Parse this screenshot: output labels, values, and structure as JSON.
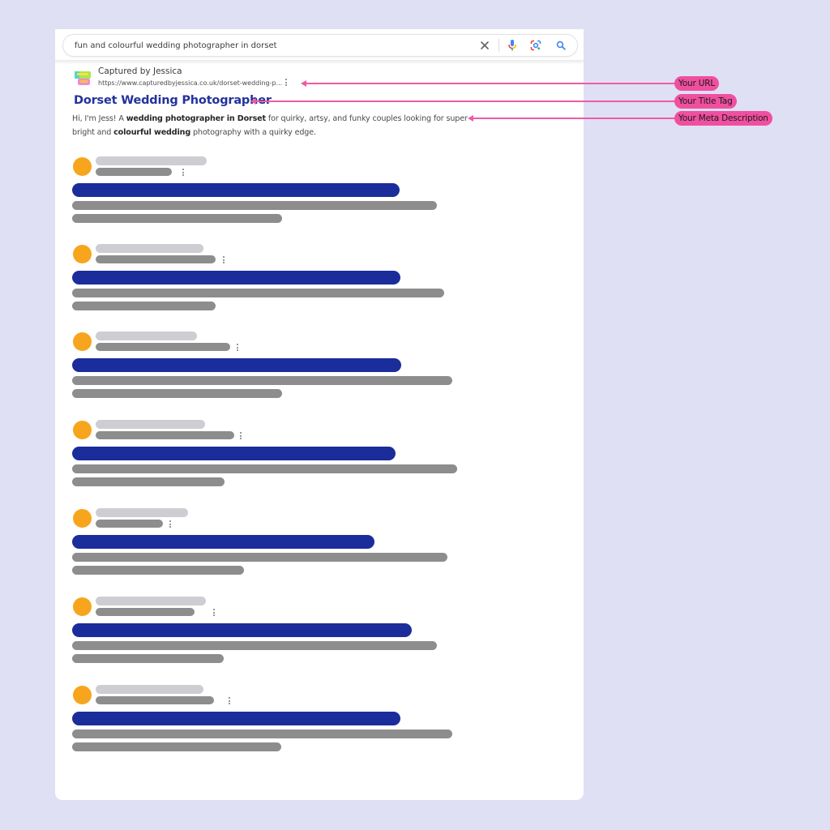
{
  "search": {
    "query": "fun and colourful wedding photographer in dorset",
    "clear_icon": "close-icon",
    "mic_icon": "microphone-icon",
    "lens_icon": "google-lens-icon",
    "search_icon": "search-icon"
  },
  "featured_result": {
    "site_name": "Captured by Jessica",
    "url": "https://www.capturedbyjessica.co.uk/dorset-wedding-p...",
    "title": "Dorset Wedding Photographer",
    "description": {
      "line1_parts": [
        {
          "text": "Hi, I'm Jess! A ",
          "bold": false
        },
        {
          "text": "wedding photographer in Dorset",
          "bold": true
        },
        {
          "text": " for quirky, artsy, and funky couples looking for super",
          "bold": false
        }
      ],
      "line2_parts": [
        {
          "text": "bright and ",
          "bold": false
        },
        {
          "text": "colourful wedding",
          "bold": true
        },
        {
          "text": " photography with a quirky edge.",
          "bold": false
        }
      ]
    },
    "more_icon": "more-vertical-icon",
    "favicon": "captured-by-jessica-logo"
  },
  "placeholder_results": {
    "count": 7,
    "favicon_color": "#f7a51d",
    "title_bar_color": "#1b2d9a",
    "text_bar_color": "#8d8d8d",
    "site_bar_color": "#cdcdd2"
  },
  "annotations": [
    {
      "label": "Your URL",
      "points_to": "url"
    },
    {
      "label": "Your Title Tag",
      "points_to": "title"
    },
    {
      "label": "Your Meta Description",
      "points_to": "description"
    }
  ],
  "colors": {
    "background": "#dfe0f3",
    "card": "#ffffff",
    "annotation_pink": "#f04fa0",
    "title_blue": "#23329c"
  }
}
